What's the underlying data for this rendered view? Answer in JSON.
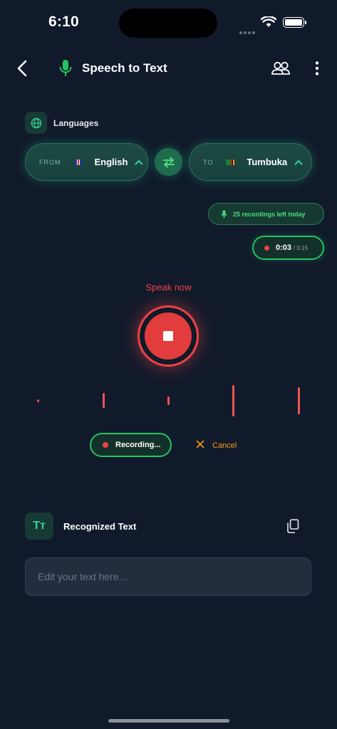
{
  "status": {
    "time": "6:10"
  },
  "header": {
    "title": "Speech to Text"
  },
  "languages": {
    "label": "Languages",
    "from": {
      "label": "FROM",
      "name": "English"
    },
    "to": {
      "label": "TO",
      "name": "Tumbuka"
    }
  },
  "recordings_left": "25 recordings left today",
  "timer": {
    "current": "0:03",
    "total": "/ 0:15"
  },
  "prompt": "Speak now",
  "recording_label": "Recording...",
  "cancel_label": "Cancel",
  "recognized": {
    "title": "Recognized Text",
    "icon_text": "Tт",
    "placeholder": "Edit your text here..."
  },
  "colors": {
    "background": "#111a2b",
    "accent_green": "#22c55e",
    "record_red": "#ef4444",
    "cancel_orange": "#f59e0b"
  }
}
